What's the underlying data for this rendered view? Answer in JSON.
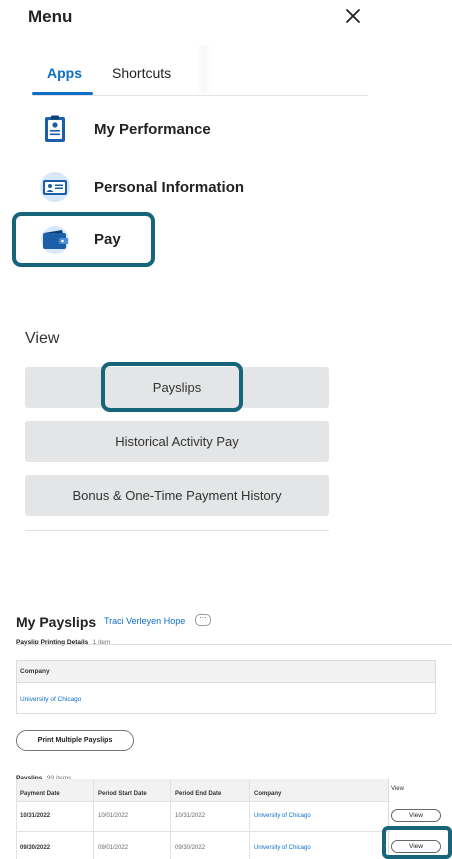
{
  "menu": {
    "title": "Menu",
    "tabs": [
      {
        "label": "Apps",
        "active": true
      },
      {
        "label": "Shortcuts",
        "active": false
      }
    ],
    "apps": [
      {
        "label": "My Performance",
        "icon": "clipboard-icon"
      },
      {
        "label": "Personal Information",
        "icon": "id-card-icon"
      },
      {
        "label": "Pay",
        "icon": "wallet-icon",
        "highlighted": true
      }
    ]
  },
  "view_section": {
    "heading": "View",
    "buttons": [
      {
        "label": "Payslips",
        "highlighted": true
      },
      {
        "label": "Historical Activity Pay"
      },
      {
        "label": "Bonus & One-Time Payment History"
      }
    ]
  },
  "payslips": {
    "title": "My Payslips",
    "person": "Traci Verleyen Hope",
    "more_label": "⋯",
    "printing_details": {
      "label": "Payslip Printing Details",
      "count": "1 item",
      "column": "Company",
      "value": "University of Chicago"
    },
    "print_button": "Print Multiple Payslips",
    "table": {
      "label": "Payslips",
      "count": "99 items",
      "columns": [
        "Payment Date",
        "Period Start Date",
        "Period End Date",
        "Company",
        "View"
      ],
      "rows": [
        {
          "payment_date": "10/31/2022",
          "period_start": "10/01/2022",
          "period_end": "10/31/2022",
          "company": "University of Chicago",
          "view": "View"
        },
        {
          "payment_date": "09/30/2022",
          "period_start": "09/01/2022",
          "period_end": "09/30/2022",
          "company": "University of Chicago",
          "view": "View",
          "highlighted": true
        }
      ]
    }
  },
  "colors": {
    "accent_blue": "#0f6fc6",
    "highlight_border": "#16657a",
    "button_gray": "#e3e5e6"
  }
}
